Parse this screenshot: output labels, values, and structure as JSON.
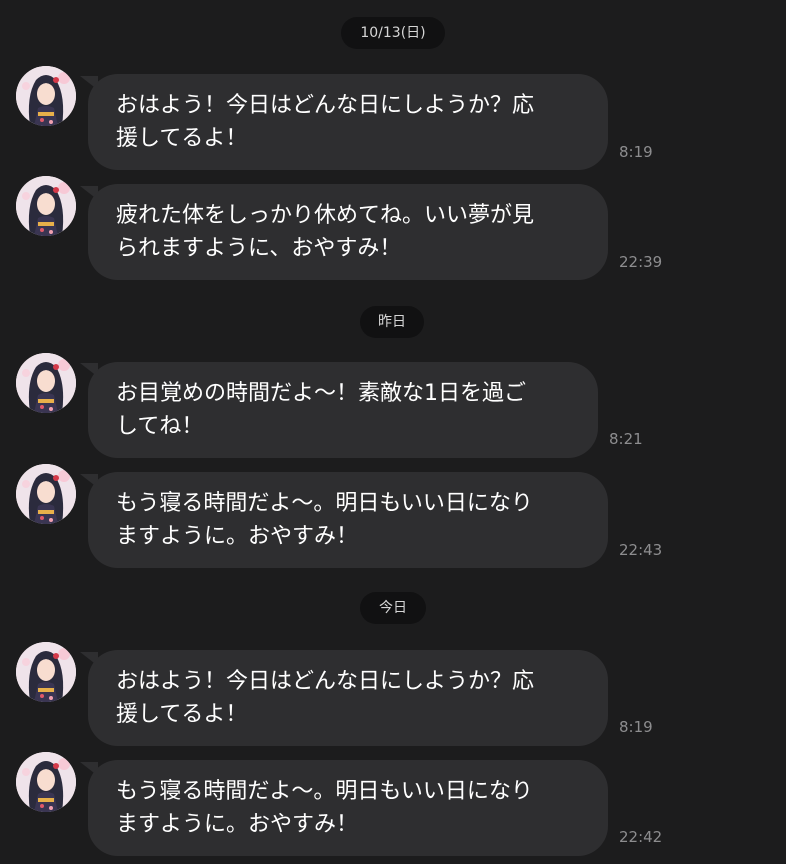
{
  "dates": {
    "d1": "10/13(日)",
    "d2": "昨日",
    "d3": "今日"
  },
  "messages": [
    {
      "lines": [
        "おはよう！今日はどんな日にしようか？応",
        "援してるよ！"
      ],
      "time": "8:19"
    },
    {
      "lines": [
        "疲れた体をしっかり休めてね。いい夢が見",
        "られますように、おやすみ！"
      ],
      "time": "22:39"
    },
    {
      "lines": [
        "お目覚めの時間だよ〜！素敵な1日を過ご",
        "してね！"
      ],
      "time": "8:21"
    },
    {
      "lines": [
        "もう寝る時間だよ〜。明日もいい日になり",
        "ますように。おやすみ！"
      ],
      "time": "22:43"
    },
    {
      "lines": [
        "おはよう！今日はどんな日にしようか？応",
        "援してるよ！"
      ],
      "time": "8:19"
    },
    {
      "lines": [
        "もう寝る時間だよ〜。明日もいい日になり",
        "ますように。おやすみ！"
      ],
      "time": "22:42"
    }
  ],
  "avatar_icon": "anime-girl-kimono-avatar",
  "colors": {
    "background": "#1c1c1d",
    "bubble": "#2e2e30",
    "date_pill": "#111112",
    "time_text": "#8d8d8f"
  }
}
